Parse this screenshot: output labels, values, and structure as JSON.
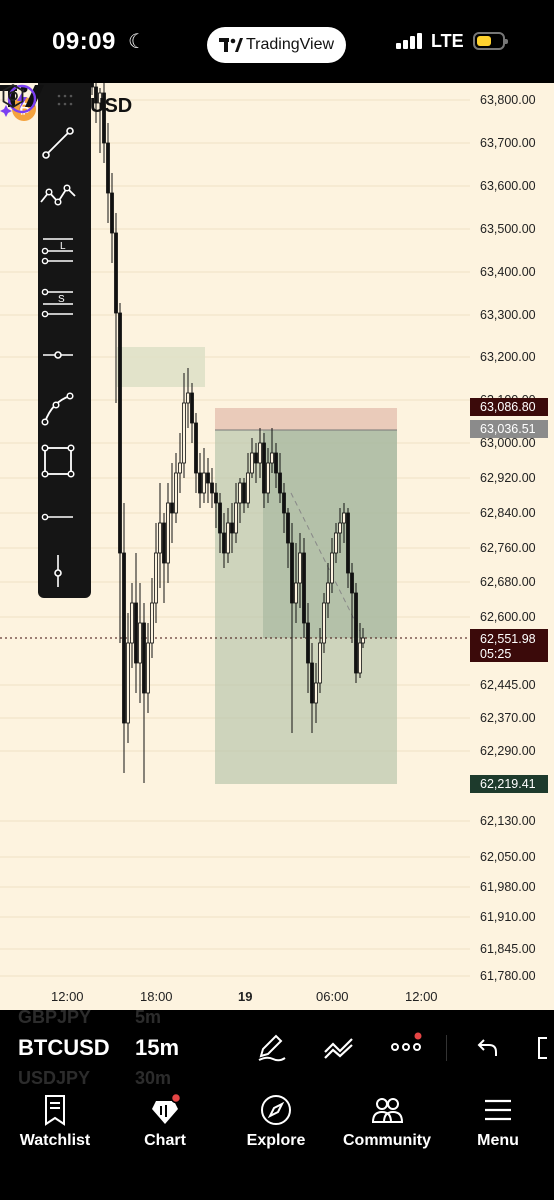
{
  "status_bar": {
    "time": "09:09",
    "network": "LTE",
    "app_pill": "TradingView"
  },
  "chart": {
    "symbol_suffix": "USD",
    "price_axis": [
      "63,800.00",
      "63,700.00",
      "63,600.00",
      "63,500.00",
      "63,400.00",
      "63,300.00",
      "63,200.00",
      "63,100.00",
      "63,000.00",
      "62,920.00",
      "62,840.00",
      "62,760.00",
      "62,680.00",
      "62,600.00",
      "62,445.00",
      "62,370.00",
      "62,290.00",
      "62,130.00",
      "62,050.00",
      "61,980.00",
      "61,910.00",
      "61,845.00",
      "61,780.00"
    ],
    "price_tags": {
      "stop": "63,086.80",
      "entry": "63,036.51",
      "current": "62,551.98",
      "countdown": "05:25",
      "target": "62,219.41"
    },
    "time_axis": [
      "12:00",
      "18:00",
      "19",
      "06:00",
      "12:00"
    ],
    "colors": {
      "background": "#fdf3df",
      "stop_zone": "#e8c6b6",
      "profit_zone": "#b9c6ad",
      "current_tag": "#3b0a0a",
      "entry_tag": "#8b8b8b",
      "target_tag": "#1d3a2c"
    }
  },
  "drawing_tools": [
    "trend-line",
    "path",
    "long-position",
    "short-position",
    "horizontal-ray",
    "curve",
    "rectangle",
    "horizontal-line",
    "vertical-line"
  ],
  "symbol_bar": {
    "prev_symbol": "GBPJPY",
    "prev_interval": "5m",
    "symbol": "BTCUSD",
    "interval": "15m",
    "next_symbol": "USDJPY",
    "next_interval": "30m"
  },
  "tabs": [
    {
      "label": "Watchlist",
      "icon": "watchlist-icon"
    },
    {
      "label": "Chart",
      "icon": "chart-icon"
    },
    {
      "label": "Explore",
      "icon": "compass-icon"
    },
    {
      "label": "Community",
      "icon": "community-icon"
    },
    {
      "label": "Menu",
      "icon": "menu-icon"
    }
  ]
}
